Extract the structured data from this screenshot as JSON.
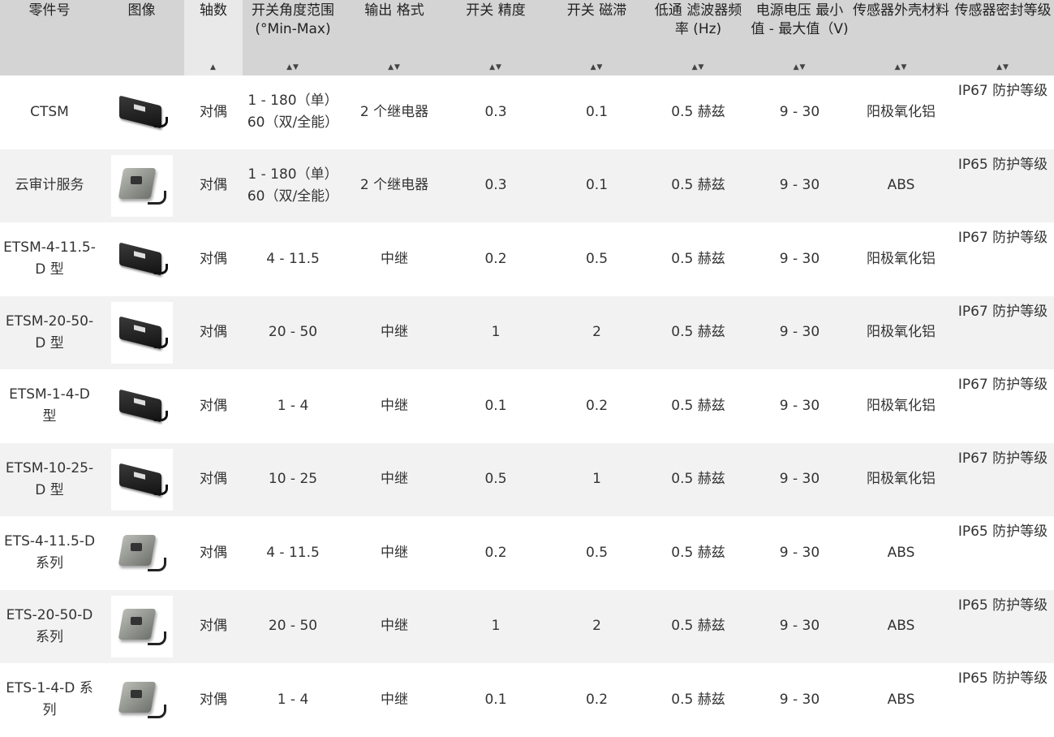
{
  "columns": [
    {
      "label": "零件号",
      "sortable": false
    },
    {
      "label": "图像",
      "sortable": false
    },
    {
      "label": "轴数",
      "sortable": true,
      "sort_glyph": "▲"
    },
    {
      "label": "开关角度范围 (°Min-Max)",
      "sortable": true,
      "sort_glyph": "▲▼"
    },
    {
      "label": "输出 格式",
      "sortable": true,
      "sort_glyph": "▲▼"
    },
    {
      "label": "开关 精度",
      "sortable": true,
      "sort_glyph": "▲▼"
    },
    {
      "label": "开关 磁滞",
      "sortable": true,
      "sort_glyph": "▲▼"
    },
    {
      "label": "低通 滤波器频率 (Hz)",
      "sortable": true,
      "sort_glyph": "▲▼"
    },
    {
      "label": "电源电压 最小值 - 最大值（V)",
      "sortable": true,
      "sort_glyph": "▲▼"
    },
    {
      "label": "传感器外壳材料",
      "sortable": true,
      "sort_glyph": "▲▼"
    },
    {
      "label": "传感器密封等级",
      "sortable": true,
      "sort_glyph": "▲▼"
    }
  ],
  "rows": [
    {
      "part": "CTSM",
      "image": "black-sensor",
      "axes": "对偶",
      "range": "1 - 180（单） 60（双/全能）",
      "output": "2 个继电器",
      "accuracy": "0.3",
      "hysteresis": "0.1",
      "filter": "0.5 赫兹",
      "voltage": "9 - 30",
      "housing": "阳极氧化铝",
      "seal": "IP67 防护等级"
    },
    {
      "part": "云审计服务",
      "image": "grey-sensor",
      "axes": "对偶",
      "range": "1 - 180（单） 60（双/全能）",
      "output": "2 个继电器",
      "accuracy": "0.3",
      "hysteresis": "0.1",
      "filter": "0.5 赫兹",
      "voltage": "9 - 30",
      "housing": "ABS",
      "seal": "IP65 防护等级"
    },
    {
      "part": "ETSM-4-11.5-D 型",
      "image": "black-sensor",
      "axes": "对偶",
      "range": "4 - 11.5",
      "output": "中继",
      "accuracy": "0.2",
      "hysteresis": "0.5",
      "filter": "0.5 赫兹",
      "voltage": "9 - 30",
      "housing": "阳极氧化铝",
      "seal": "IP67 防护等级"
    },
    {
      "part": "ETSM-20-50-D 型",
      "image": "black-sensor",
      "axes": "对偶",
      "range": "20 - 50",
      "output": "中继",
      "accuracy": "1",
      "hysteresis": "2",
      "filter": "0.5 赫兹",
      "voltage": "9 - 30",
      "housing": "阳极氧化铝",
      "seal": "IP67 防护等级"
    },
    {
      "part": "ETSM-1-4-D 型",
      "image": "black-sensor",
      "axes": "对偶",
      "range": "1 - 4",
      "output": "中继",
      "accuracy": "0.1",
      "hysteresis": "0.2",
      "filter": "0.5 赫兹",
      "voltage": "9 - 30",
      "housing": "阳极氧化铝",
      "seal": "IP67 防护等级"
    },
    {
      "part": "ETSM-10-25-D 型",
      "image": "black-sensor",
      "axes": "对偶",
      "range": "10 - 25",
      "output": "中继",
      "accuracy": "0.5",
      "hysteresis": "1",
      "filter": "0.5 赫兹",
      "voltage": "9 - 30",
      "housing": "阳极氧化铝",
      "seal": "IP67 防护等级"
    },
    {
      "part": "ETS-4-11.5-D 系列",
      "image": "grey-sensor",
      "axes": "对偶",
      "range": "4 - 11.5",
      "output": "中继",
      "accuracy": "0.2",
      "hysteresis": "0.5",
      "filter": "0.5 赫兹",
      "voltage": "9 - 30",
      "housing": "ABS",
      "seal": "IP65 防护等级"
    },
    {
      "part": "ETS-20-50-D 系列",
      "image": "grey-sensor",
      "axes": "对偶",
      "range": "20 - 50",
      "output": "中继",
      "accuracy": "1",
      "hysteresis": "2",
      "filter": "0.5 赫兹",
      "voltage": "9 - 30",
      "housing": "ABS",
      "seal": "IP65 防护等级"
    },
    {
      "part": "ETS-1-4-D 系列",
      "image": "grey-sensor",
      "axes": "对偶",
      "range": "1 - 4",
      "output": "中继",
      "accuracy": "0.1",
      "hysteresis": "0.2",
      "filter": "0.5 赫兹",
      "voltage": "9 - 30",
      "housing": "ABS",
      "seal": "IP65 防护等级"
    }
  ]
}
